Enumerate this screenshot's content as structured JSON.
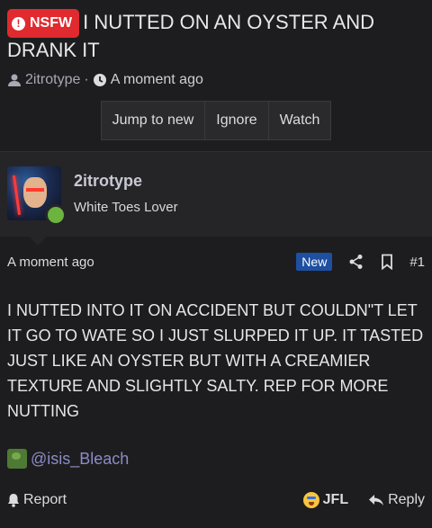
{
  "thread": {
    "badge": "NSFW",
    "title": "I NUTTED ON AN OYSTER AND DRANK IT",
    "author": "2itrotype",
    "time": "A moment ago",
    "separator": "·"
  },
  "actions": {
    "jump_to_new": "Jump to new",
    "ignore": "Ignore",
    "watch": "Watch"
  },
  "post": {
    "author_name": "2itrotype",
    "author_title": "White Toes Lover",
    "time": "A moment ago",
    "new_label": "New",
    "number": "#1",
    "message": "I NUTTED INTO IT ON ACCIDENT BUT COULDN\"T LET IT GO TO WATE SO I JUST SLURPED IT UP. IT TASTED JUST LIKE AN OYSTER BUT WITH A CREAMIER TEXTURE AND SLIGHTLY SALTY. REP FOR MORE NUTTING",
    "signature": "@isis_Bleach"
  },
  "footer": {
    "report": "Report",
    "reaction": "JFL",
    "reply": "Reply"
  },
  "colors": {
    "nsfw": "#e02a2f",
    "new_badge": "#1e4fa0",
    "online": "#6cb33f",
    "signature_link": "#8c8cc8"
  },
  "icons": [
    "alert-icon",
    "user-icon",
    "clock-icon",
    "share-icon",
    "bookmark-icon",
    "bell-icon",
    "reply-icon",
    "online-status-icon"
  ]
}
